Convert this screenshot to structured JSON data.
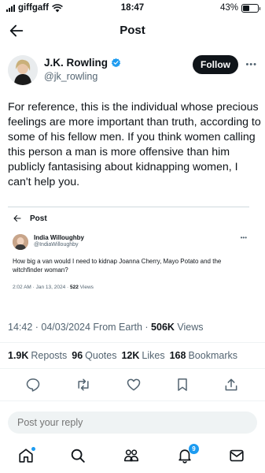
{
  "status_bar": {
    "carrier": "giffgaff",
    "time": "18:47",
    "battery_percent": "43%",
    "battery_level": 0.43
  },
  "header": {
    "title": "Post"
  },
  "author": {
    "name": "J.K. Rowling",
    "handle": "@jk_rowling",
    "follow_label": "Follow",
    "verified_color": "#1d9bf0"
  },
  "tweet": {
    "text": "For reference, this is the individual whose precious feelings are more important than truth, according to some of his fellow men. If you think women calling this person a man is more offensive than him publicly fantasising about kidnapping women, I can't help you."
  },
  "quoted_screenshot": {
    "header_title": "Post",
    "author_name": "India Willoughby",
    "author_handle": "@IndiaWilloughby",
    "text": "How big a van would I need to kidnap Joanna Cherry, Mayo Potato and the witchfinder woman?",
    "timestamp": "2:02 AM · Jan 13, 2024 · ",
    "views_count": "522",
    "views_label": " Views"
  },
  "meta": {
    "timestamp": "14:42 · 04/03/2024 From Earth · ",
    "views_count": "506K",
    "views_label": " Views"
  },
  "stats": [
    {
      "count": "1.9K",
      "label": "Reposts"
    },
    {
      "count": "96",
      "label": "Quotes"
    },
    {
      "count": "12K",
      "label": "Likes"
    },
    {
      "count": "168",
      "label": "Bookmarks"
    }
  ],
  "actions": [
    "reply-icon",
    "repost-icon",
    "like-icon",
    "bookmark-icon",
    "share-icon"
  ],
  "reply": {
    "placeholder": "Post your reply"
  },
  "tabbar": {
    "notification_count": "9",
    "accent_color": "#1d9bf0"
  }
}
